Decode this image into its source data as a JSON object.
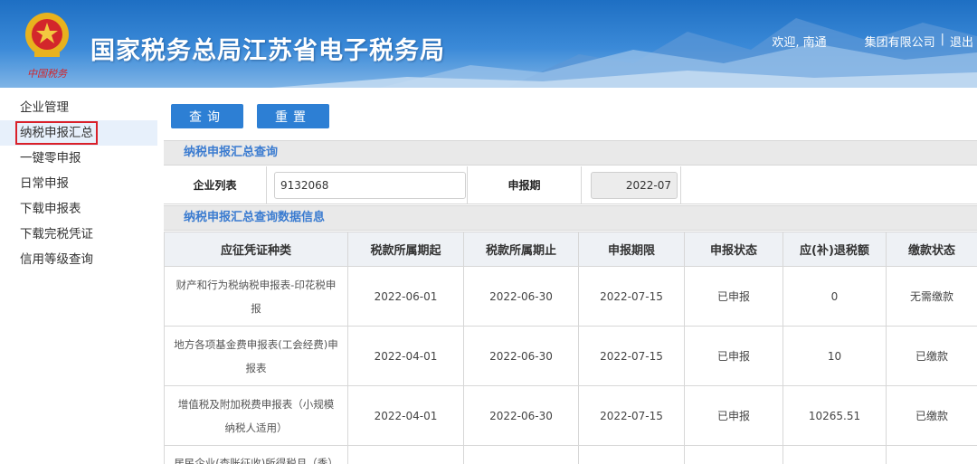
{
  "header": {
    "title": "国家税务总局江苏省电子税务局",
    "welcome": "欢迎, 南通",
    "company": "集团有限公司",
    "separator": "|",
    "logout": "退出",
    "emblem_caption": "中国税务"
  },
  "sidebar": {
    "items": [
      {
        "label": "企业管理"
      },
      {
        "label": "纳税申报汇总"
      },
      {
        "label": "一键零申报"
      },
      {
        "label": "日常申报"
      },
      {
        "label": "下载申报表"
      },
      {
        "label": "下载完税凭证"
      },
      {
        "label": "信用等级查询"
      }
    ]
  },
  "toolbar": {
    "query_label": "查询",
    "reset_label": "重置"
  },
  "query_section": {
    "title": "纳税申报汇总查询",
    "company_list_label": "企业列表",
    "company_list_value": "9132068",
    "period_label": "申报期",
    "period_value": "2022-07"
  },
  "result_section": {
    "title": "纳税申报汇总查询数据信息",
    "columns": [
      "应征凭证种类",
      "税款所属期起",
      "税款所属期止",
      "申报期限",
      "申报状态",
      "应(补)退税额",
      "缴款状态"
    ],
    "rows": [
      {
        "name": "财产和行为税纳税申报表-印花税申报",
        "start": "2022-06-01",
        "end": "2022-06-30",
        "deadline": "2022-07-15",
        "status": "已申报",
        "amount": "0",
        "pay": "无需缴款"
      },
      {
        "name": "地方各项基金费申报表(工会经费)申报表",
        "start": "2022-04-01",
        "end": "2022-06-30",
        "deadline": "2022-07-15",
        "status": "已申报",
        "amount": "10",
        "pay": "已缴款"
      },
      {
        "name": "增值税及附加税费申报表（小规模纳税人适用）",
        "start": "2022-04-01",
        "end": "2022-06-30",
        "deadline": "2022-07-15",
        "status": "已申报",
        "amount": "10265.51",
        "pay": "已缴款"
      },
      {
        "name": "居民企业(查账征收)所得税月（季）",
        "start": "",
        "end": "",
        "deadline": "",
        "status": "",
        "amount": "",
        "pay": ""
      }
    ]
  },
  "colors": {
    "accent": "#2d7fd4",
    "section_title": "#3a7bd0",
    "status_ok": "#2e8b2e",
    "pay_done": "#e89a2e",
    "highlight_border": "#d9202a"
  }
}
